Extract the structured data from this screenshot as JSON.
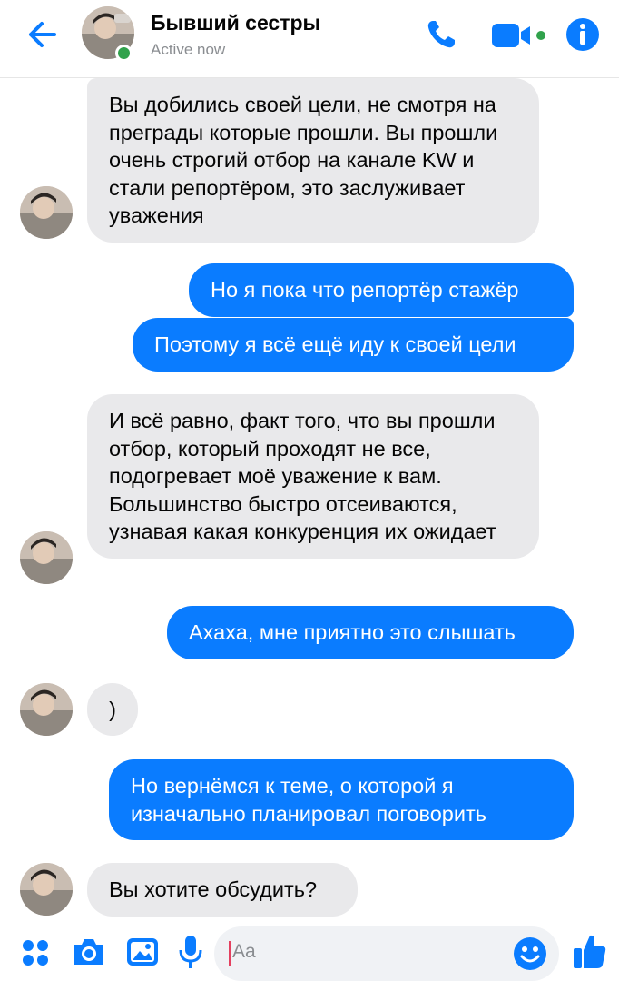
{
  "header": {
    "contact_name": "Бывший сестры",
    "status": "Active now",
    "accent_color": "#0a7cff",
    "online_color": "#31a24c",
    "icons": [
      "back-arrow-icon",
      "phone-icon",
      "video-camera-icon",
      "info-icon"
    ]
  },
  "messages": [
    {
      "direction": "incoming",
      "text": "Вы добились своей цели, не смотря на преграды которые прошли. Вы прошли очень строгий отбор на канале KW и стали репортёром, это заслуживает уважения"
    },
    {
      "direction": "outgoing",
      "text": "Но я пока что репортёр стажёр"
    },
    {
      "direction": "outgoing",
      "text": "Поэтому я всё ещё иду к своей цели"
    },
    {
      "direction": "incoming",
      "text": "И всё равно, факт того, что вы прошли отбор, который проходят не все, подогревает моё уважение к вам. Большинство быстро отсеиваются, узнавая какая конкуренция их ожидает"
    },
    {
      "direction": "outgoing",
      "text": "Ахаха, мне приятно это слышать"
    },
    {
      "direction": "incoming",
      "text": ")"
    },
    {
      "direction": "outgoing",
      "text": "Но вернёмся к теме, о которой я изначально планировал поговорить"
    },
    {
      "direction": "incoming",
      "text": "Вы хотите обсудить?"
    }
  ],
  "composer": {
    "placeholder": "Aa",
    "icons": [
      "apps-grid-icon",
      "camera-icon",
      "gallery-icon",
      "microphone-icon",
      "emoji-icon",
      "like-thumb-icon"
    ]
  }
}
